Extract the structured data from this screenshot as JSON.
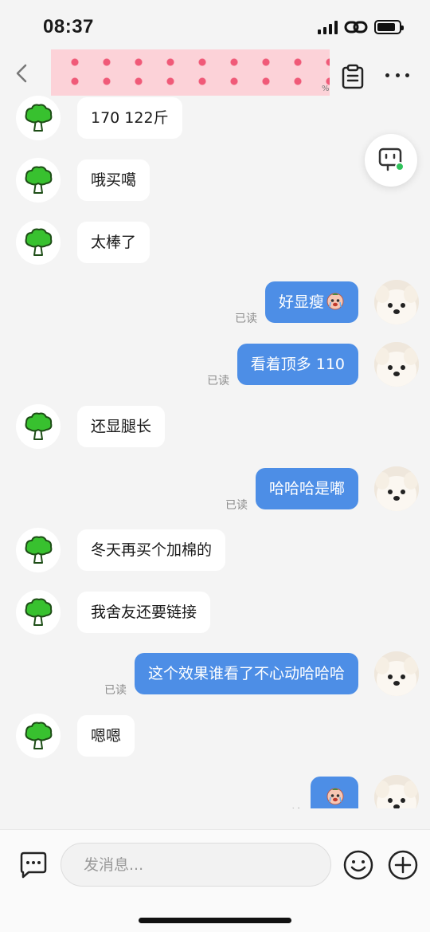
{
  "status_bar": {
    "time": "08:37",
    "battery_level": 0.85
  },
  "header": {
    "back_icon": "chevron-left-icon",
    "title_percent": "%",
    "clipboard_icon": "clipboard-icon",
    "more_icon": "more-icon"
  },
  "float_bot": {
    "icon": "bot-icon",
    "status_color": "#2fc25b"
  },
  "theme": {
    "outgoing_bubble": "#4d8ee6",
    "incoming_bubble": "#ffffff",
    "background": "#f4f4f4"
  },
  "messages": [
    {
      "side": "left",
      "text": "170 122斤"
    },
    {
      "side": "left",
      "text": "哦买噶"
    },
    {
      "side": "left",
      "text": "太棒了"
    },
    {
      "side": "right",
      "text": "好显瘦",
      "emoji": "crying-face",
      "read": "已读"
    },
    {
      "side": "right",
      "text": "看着顶多 110",
      "read": "已读"
    },
    {
      "side": "left",
      "text": "还显腿长"
    },
    {
      "side": "right",
      "text": "哈哈哈是嘟",
      "read": "已读"
    },
    {
      "side": "left",
      "text": "冬天再买个加棉的"
    },
    {
      "side": "left",
      "text": "我舍友还要链接"
    },
    {
      "side": "right",
      "text": "这个效果谁看了不心动哈哈哈",
      "read": "已读"
    },
    {
      "side": "left",
      "text": "嗯嗯"
    },
    {
      "side": "right",
      "text": "",
      "emoji": "crying-face",
      "read": "已读"
    }
  ],
  "composer": {
    "placeholder": "发消息...",
    "chat_icon": "message-icon",
    "emoji_icon": "emoji-icon",
    "plus_icon": "plus-icon"
  }
}
